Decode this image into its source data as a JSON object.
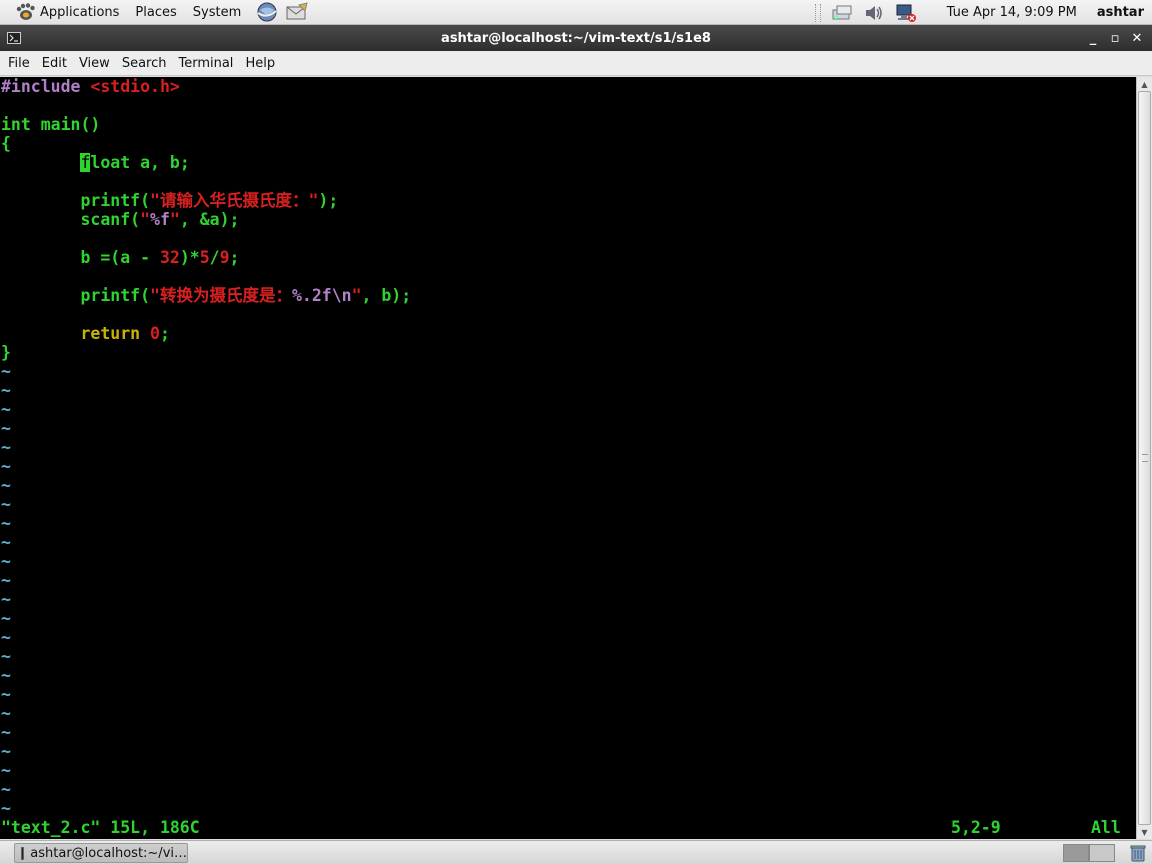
{
  "top_panel": {
    "menus": [
      "Applications",
      "Places",
      "System"
    ],
    "clock": "Tue Apr 14,  9:09 PM",
    "user": "ashtar"
  },
  "window": {
    "title": "ashtar@localhost:~/vim-text/s1/s1e8",
    "minimize": "_",
    "maximize": "▫",
    "close": "✕"
  },
  "menubar": [
    "File",
    "Edit",
    "View",
    "Search",
    "Terminal",
    "Help"
  ],
  "editor": {
    "file_lines": [
      [
        {
          "t": "#include ",
          "c": "c-pre"
        },
        {
          "t": "<stdio.h>",
          "c": "c-str"
        }
      ],
      [],
      [
        {
          "t": "int main()",
          "c": "c-code"
        }
      ],
      [
        {
          "t": "{",
          "c": "c-code"
        }
      ],
      [
        {
          "t": "        ",
          "c": ""
        },
        {
          "t": "f",
          "c": "cursor"
        },
        {
          "t": "loat",
          "c": "c-type"
        },
        {
          "t": " a, b;",
          "c": "c-code"
        }
      ],
      [],
      [
        {
          "t": "        printf(",
          "c": "c-code"
        },
        {
          "t": "\"请输入华氏摄氏度：\"",
          "c": "c-str"
        },
        {
          "t": ");",
          "c": "c-code"
        }
      ],
      [
        {
          "t": "        scanf(",
          "c": "c-code"
        },
        {
          "t": "\"",
          "c": "c-str"
        },
        {
          "t": "%f",
          "c": "c-fmt"
        },
        {
          "t": "\"",
          "c": "c-str"
        },
        {
          "t": ", &a);",
          "c": "c-code"
        }
      ],
      [],
      [
        {
          "t": "        b =(a - ",
          "c": "c-code"
        },
        {
          "t": "32",
          "c": "c-num"
        },
        {
          "t": ")*",
          "c": "c-code"
        },
        {
          "t": "5",
          "c": "c-num"
        },
        {
          "t": "/",
          "c": "c-code"
        },
        {
          "t": "9",
          "c": "c-num"
        },
        {
          "t": ";",
          "c": "c-code"
        }
      ],
      [],
      [
        {
          "t": "        printf(",
          "c": "c-code"
        },
        {
          "t": "\"转换为摄氏度是：",
          "c": "c-str"
        },
        {
          "t": "%.2f\\n",
          "c": "c-fmt"
        },
        {
          "t": "\"",
          "c": "c-str"
        },
        {
          "t": ", b);",
          "c": "c-code"
        }
      ],
      [],
      [
        {
          "t": "        ",
          "c": ""
        },
        {
          "t": "return",
          "c": "c-kw"
        },
        {
          "t": " ",
          "c": ""
        },
        {
          "t": "0",
          "c": "c-num"
        },
        {
          "t": ";",
          "c": "c-code"
        }
      ],
      [
        {
          "t": "}",
          "c": "c-code"
        }
      ]
    ],
    "tilde": "~",
    "tilde_count": 24,
    "status_message": "\"text_2.c\" 15L, 186C",
    "cursor_position": "5,2-9",
    "scroll_position": "All"
  },
  "taskbar": {
    "task_label": "ashtar@localhost:~/vi…"
  },
  "colors": {
    "terminal_bg": "#000000",
    "code_green": "#2fd42f",
    "string_red": "#d82020",
    "preproc_purple": "#b080c8",
    "keyword_yellow": "#c8b400",
    "tilde_blue": "#5fb0d0"
  }
}
